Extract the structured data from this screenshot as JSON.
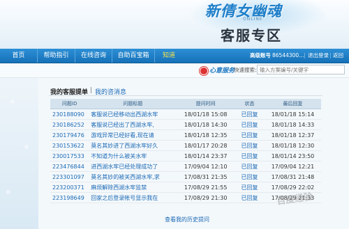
{
  "banner": {
    "logo_text": "新倩女幽魂",
    "logo_sub": "ONLINE",
    "heading": "客服专区"
  },
  "nav": {
    "items": [
      {
        "label": "首页"
      },
      {
        "label": "帮助指引"
      },
      {
        "label": "在线咨询"
      },
      {
        "label": "自助百宝箱"
      },
      {
        "label": "知道"
      }
    ],
    "account_label": "高级账号",
    "account_value": "86544300...",
    "link_logout": "退出登录",
    "link_back": "返回"
  },
  "subbar": {
    "brand": "心意服务",
    "search_label": "快速搜索:",
    "search_placeholder": "输入方案编号/关键字"
  },
  "tabs": {
    "active": "我的客服提单",
    "other": "我的咨消息"
  },
  "table": {
    "headers": [
      "问题ID",
      "问题标题",
      "提问时间",
      "状态",
      "最后回复"
    ],
    "rows": [
      {
        "id": "230188090",
        "title": "客服说已经移动出西湖水牢",
        "time": "18/01/18 15:08",
        "status": "已回复",
        "last": "18/01/18 15:14"
      },
      {
        "id": "230186252",
        "title": "客服说已经出了西湖水牢,",
        "time": "18/01/18 14:30",
        "status": "已回复",
        "last": "18/01/18 14:33"
      },
      {
        "id": "230179476",
        "title": "游戏异常已经好看,现在请",
        "time": "18/01/18 12:35",
        "status": "已回复",
        "last": "18/01/18 12:37"
      },
      {
        "id": "230153622",
        "title": "莫名其妙进了西湖水牢好久",
        "time": "18/01/17 20:28",
        "status": "已回复",
        "last": "18/01/18 12:30"
      },
      {
        "id": "230017533",
        "title": "不知道为什么被关水牢",
        "time": "18/01/14 23:37",
        "status": "已回复",
        "last": "18/01/14 23:50"
      },
      {
        "id": "223476844",
        "title": "进西湖水牢已经处理成功了",
        "time": "17/09/04 12:10",
        "status": "已回复",
        "last": "17/09/04 12:21"
      },
      {
        "id": "223301097",
        "title": "莫名其妙的被关西湖水牢,求",
        "time": "17/08/31 21:35",
        "status": "已回复",
        "last": "17/08/31 21:48"
      },
      {
        "id": "223200371",
        "title": "麻烦解除西湖水牢监禁",
        "time": "17/08/29 21:55",
        "status": "已回复",
        "last": "17/08/29 22:02"
      },
      {
        "id": "223198649",
        "title": "回家之后登录帐号显示我在",
        "time": "17/08/29 21:30",
        "status": "已回复",
        "last": "17/08/29 21:33"
      }
    ]
  },
  "history_link": "查看我的历史提问",
  "watermark": "百度经验"
}
